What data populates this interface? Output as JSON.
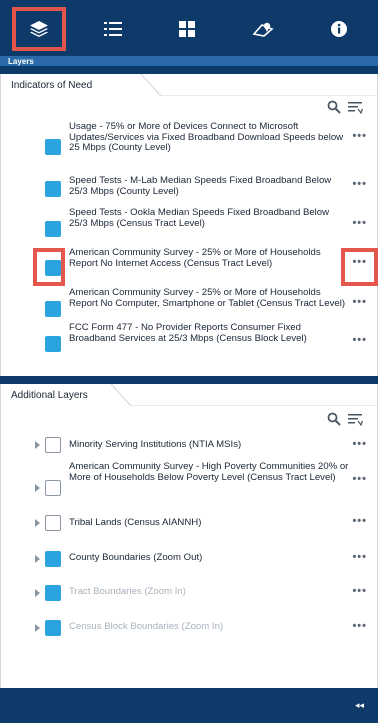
{
  "toolbar": {
    "icons": [
      "layers-icon",
      "legend-list-icon",
      "basemap-grid-icon",
      "map-pin-icon",
      "info-icon"
    ]
  },
  "panel_title": "Layers",
  "indicators": {
    "title": "Indicators of Need",
    "items": [
      {
        "label": "Usage - 75% or More of Devices Connect to Microsoft Updates/Services via Fixed Broadband Download Speeds below 25 Mbps (County Level)",
        "checked": true
      },
      {
        "label": "Speed Tests - M-Lab Median Speeds Fixed Broadband Below 25/3 Mbps (County Level)",
        "checked": true
      },
      {
        "label": "Speed Tests - Ookla Median Speeds Fixed Broadband Below 25/3 Mbps (Census Tract Level)",
        "checked": true
      },
      {
        "label": "American Community Survey - 25% or More of Households Report No Internet Access (Census Tract Level)",
        "checked": true
      },
      {
        "label": "American Community Survey - 25% or More of Households Report No Computer, Smartphone or Tablet (Census Tract Level)",
        "checked": true
      },
      {
        "label": "FCC Form 477 - No Provider Reports Consumer Fixed Broadband Services at 25/3 Mbps (Census Block Level)",
        "checked": true
      }
    ]
  },
  "additional": {
    "title": "Additional Layers",
    "items": [
      {
        "label": "Minority Serving Institutions (NTIA MSIs)",
        "checked": false,
        "dim": false
      },
      {
        "label": "American Community Survey - High Poverty Communities 20% or More of Households Below Poverty Level (Census Tract Level)",
        "checked": false,
        "dim": false
      },
      {
        "label": "Tribal Lands (Census AIANNH)",
        "checked": false,
        "dim": false
      },
      {
        "label": "County Boundaries (Zoom Out)",
        "checked": true,
        "dim": false
      },
      {
        "label": "Tract Boundaries (Zoom In)",
        "checked": true,
        "dim": true
      },
      {
        "label": "Census Block Boundaries (Zoom In)",
        "checked": true,
        "dim": true
      }
    ]
  },
  "more_label": "•••",
  "collapse_label": "◂◂",
  "colors": {
    "toolbar": "#0e3a6a",
    "accent": "#2aa3df",
    "highlight": "#e2564c"
  }
}
